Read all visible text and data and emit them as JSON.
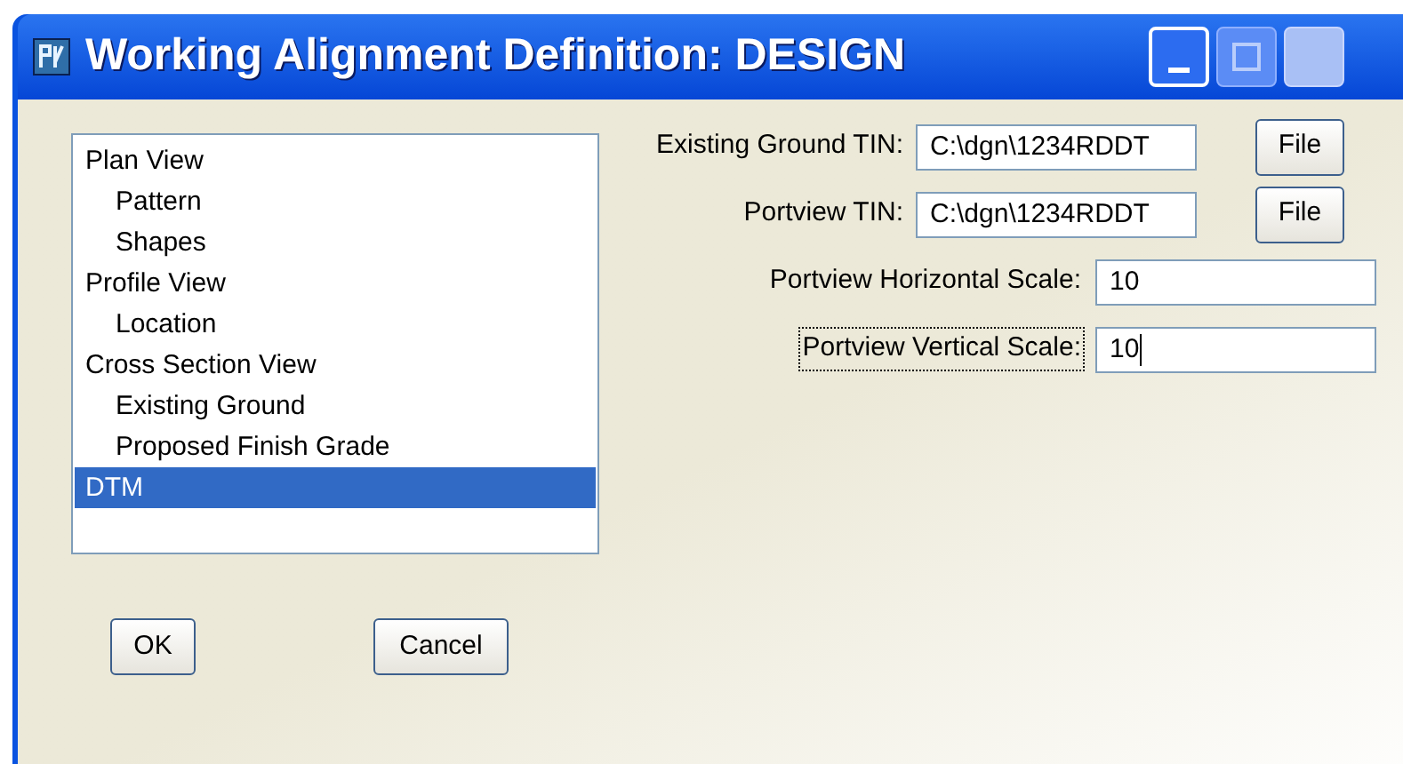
{
  "window": {
    "title": "Working Alignment Definition: DESIGN"
  },
  "tree": [
    {
      "label": "Plan View",
      "selected": false,
      "children": [
        {
          "label": "Pattern",
          "selected": false
        },
        {
          "label": "Shapes",
          "selected": false
        }
      ]
    },
    {
      "label": "Profile View",
      "selected": false,
      "children": [
        {
          "label": "Location",
          "selected": false
        }
      ]
    },
    {
      "label": "Cross Section View",
      "selected": false,
      "children": [
        {
          "label": "Existing Ground",
          "selected": false
        },
        {
          "label": "Proposed Finish Grade",
          "selected": false
        }
      ]
    },
    {
      "label": "DTM",
      "selected": true
    }
  ],
  "fields": [
    {
      "kind": "file",
      "label": "Existing Ground TIN:",
      "value": "C:\\dgn\\1234RDDT",
      "button": "File",
      "focused": false
    },
    {
      "kind": "file",
      "label": "Portview TIN:",
      "value": "C:\\dgn\\1234RDDT",
      "button": "File",
      "focused": false
    },
    {
      "kind": "text",
      "label": "Portview Horizontal Scale:",
      "value": "10",
      "focused": false
    },
    {
      "kind": "text",
      "label": "Portview Vertical Scale:",
      "value": "10",
      "focused": true
    }
  ],
  "buttons": [
    "OK",
    "Cancel"
  ]
}
